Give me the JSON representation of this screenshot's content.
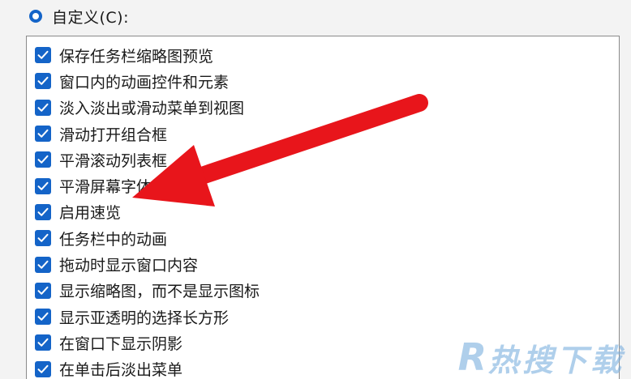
{
  "option": {
    "label": "自定义(C):",
    "selected": true
  },
  "checkboxes": [
    {
      "label": "保存任务栏缩略图预览",
      "checked": true
    },
    {
      "label": "窗口内的动画控件和元素",
      "checked": true
    },
    {
      "label": "淡入淡出或滑动菜单到视图",
      "checked": true
    },
    {
      "label": "滑动打开组合框",
      "checked": true
    },
    {
      "label": "平滑滚动列表框",
      "checked": true
    },
    {
      "label": "平滑屏幕字体边缘",
      "checked": true
    },
    {
      "label": "启用速览",
      "checked": true
    },
    {
      "label": "任务栏中的动画",
      "checked": true
    },
    {
      "label": "拖动时显示窗口内容",
      "checked": true
    },
    {
      "label": "显示缩略图，而不是显示图标",
      "checked": true
    },
    {
      "label": "显示亚透明的选择长方形",
      "checked": true
    },
    {
      "label": "在窗口下显示阴影",
      "checked": true
    },
    {
      "label": "在单击后淡出菜单",
      "checked": true
    }
  ],
  "watermark": {
    "letter": "R",
    "text": "热搜下载"
  },
  "colors": {
    "accent": "#1464c8",
    "arrow": "#e8151b",
    "watermark": "#6fa8dc"
  },
  "icons": {
    "radio": "radio-selected-icon",
    "checkbox": "checkmark-icon",
    "annotation": "red-arrow-icon"
  }
}
